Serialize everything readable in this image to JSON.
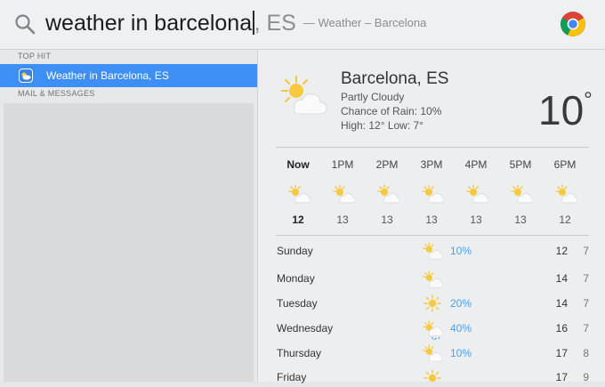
{
  "search": {
    "query": "weather in barcelona",
    "suffix": ", ES",
    "hint": "— Weather – Barcelona"
  },
  "sections": {
    "top_hit": "TOP HIT",
    "mail": "MAIL & MESSAGES"
  },
  "top_hit_result": {
    "label": "Weather in Barcelona, ES"
  },
  "weather": {
    "city": "Barcelona, ES",
    "condition": "Partly Cloudy",
    "rain": "Chance of Rain: 10%",
    "hilo": "High: 12°  Low: 7°",
    "temp": "10",
    "temp_unit": "°"
  },
  "hourly": [
    {
      "time": "Now",
      "temp": "12",
      "icon": "sun-cloud-icon"
    },
    {
      "time": "1PM",
      "temp": "13",
      "icon": "sun-cloud-icon"
    },
    {
      "time": "2PM",
      "temp": "13",
      "icon": "sun-cloud-icon"
    },
    {
      "time": "3PM",
      "temp": "13",
      "icon": "sun-cloud-icon"
    },
    {
      "time": "4PM",
      "temp": "13",
      "icon": "sun-cloud-icon"
    },
    {
      "time": "5PM",
      "temp": "13",
      "icon": "sun-cloud-icon"
    },
    {
      "time": "6PM",
      "temp": "12",
      "icon": "sun-cloud-icon"
    }
  ],
  "daily": [
    {
      "day": "Sunday",
      "rain": "10%",
      "hi": "12",
      "lo": "7",
      "icon": "sun-cloud-icon"
    },
    {
      "day": "Monday",
      "rain": "",
      "hi": "14",
      "lo": "7",
      "icon": "sun-cloud-icon"
    },
    {
      "day": "Tuesday",
      "rain": "20%",
      "hi": "14",
      "lo": "7",
      "icon": "sun-icon"
    },
    {
      "day": "Wednesday",
      "rain": "40%",
      "hi": "16",
      "lo": "7",
      "icon": "sun-rain-icon"
    },
    {
      "day": "Thursday",
      "rain": "10%",
      "hi": "17",
      "lo": "8",
      "icon": "sun-cloud-icon"
    },
    {
      "day": "Friday",
      "rain": "",
      "hi": "17",
      "lo": "9",
      "icon": "sun-icon"
    }
  ],
  "colors": {
    "selection": "#3d8ff6",
    "rain_text": "#4aa0e8",
    "sun": "#f5c63c"
  }
}
